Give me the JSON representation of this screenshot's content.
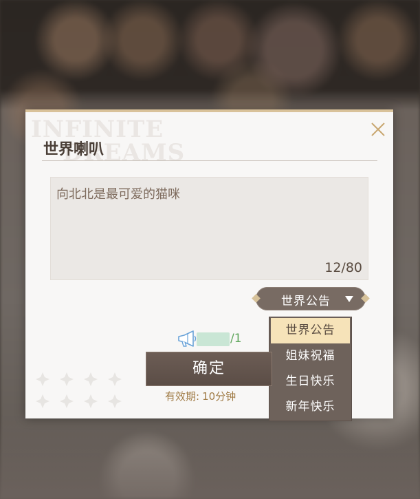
{
  "dialog": {
    "title": "世界喇叭",
    "watermark_line1": "INFINITE",
    "watermark_line2": "DREAMS",
    "close_icon": "close-icon"
  },
  "message": {
    "text": "向北北是最可爱的猫咪",
    "counter": "12/80"
  },
  "channel_select": {
    "selected": "世界公告",
    "options": [
      "世界公告",
      "姐妹祝福",
      "生日快乐",
      "新年快乐"
    ],
    "highlighted_index": 0
  },
  "inventory": {
    "icon": "megaphone-icon",
    "count_suffix": "/1"
  },
  "confirm_button": {
    "label": "确定"
  },
  "validity": {
    "label": "有效期:",
    "value": "10分钟"
  },
  "colors": {
    "accent_gold": "#d9c29a",
    "button_brown": "#6c5d55",
    "selected_option_bg": "#f6e3b9",
    "count_green": "#5fa65c",
    "validity_text": "#a07b45"
  }
}
